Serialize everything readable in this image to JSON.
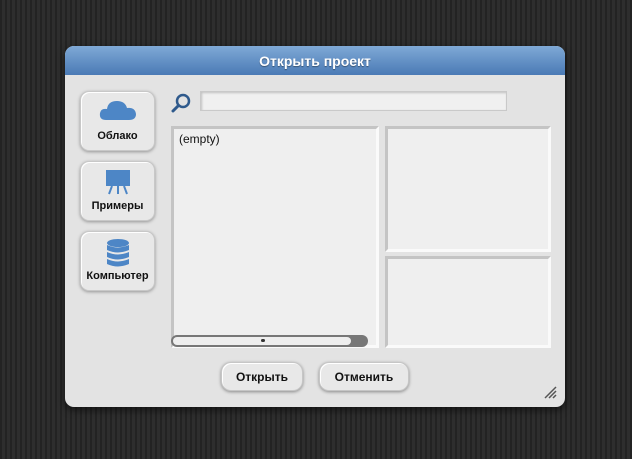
{
  "dialog": {
    "title": "Открыть проект",
    "accent_color": "#4a7ab5"
  },
  "sources": [
    {
      "label": "Облако",
      "icon": "cloud-icon"
    },
    {
      "label": "Примеры",
      "icon": "easel-icon"
    },
    {
      "label": "Компьютер",
      "icon": "database-icon"
    }
  ],
  "search": {
    "value": "",
    "icon": "search-icon"
  },
  "project_list": {
    "items": [
      "(empty)"
    ]
  },
  "buttons": {
    "open_label": "Открыть",
    "cancel_label": "Отменить"
  }
}
